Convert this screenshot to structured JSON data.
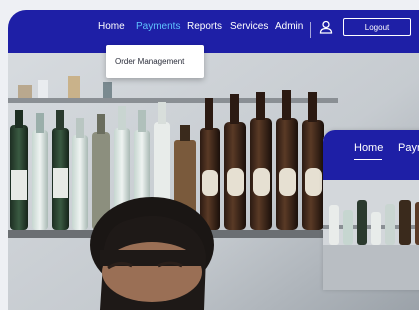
{
  "nav": {
    "items": [
      {
        "label": "Home",
        "active": false
      },
      {
        "label": "Payments",
        "active": true
      },
      {
        "label": "Reports",
        "active": false
      },
      {
        "label": "Services",
        "active": false
      },
      {
        "label": "Admin",
        "active": false
      }
    ],
    "logout_label": "Logout",
    "user_icon": "user-icon"
  },
  "dropdown": {
    "items": [
      "Order Management"
    ]
  },
  "secondary_card": {
    "nav_items": [
      "Home",
      "Payr"
    ]
  },
  "colors": {
    "nav_bg": "#1e1fa6",
    "active_link": "#5fc2ff",
    "text": "#ffffff"
  }
}
